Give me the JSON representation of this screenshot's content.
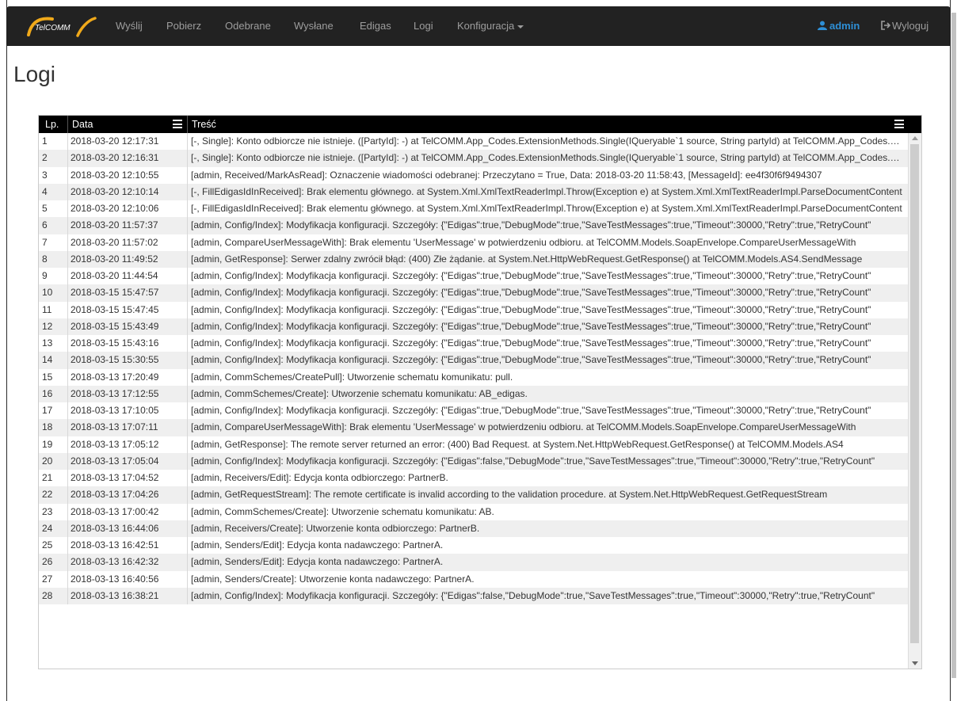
{
  "brand": {
    "logo_text": "TelCOMM"
  },
  "nav": {
    "items": [
      "Wyślij",
      "Pobierz",
      "Odebrane",
      "Wysłane",
      "Edigas",
      "Logi",
      "Konfiguracja"
    ],
    "user": "admin",
    "logout": "Wyloguj"
  },
  "page": {
    "title": "Logi"
  },
  "grid": {
    "columns": [
      "Lp.",
      "Data",
      "Treść"
    ],
    "rows": [
      [
        "1",
        "2018-03-20 12:17:31",
        "[-, Single]: Konto odbiorcze nie istnieje. ([PartyId]: -) at TelCOMM.App_Codes.ExtensionMethods.Single(IQueryable`1 source, String partyId) at TelCOMM.App_Codes.ExtensionMethods"
      ],
      [
        "2",
        "2018-03-20 12:16:31",
        "[-, Single]: Konto odbiorcze nie istnieje. ([PartyId]: -) at TelCOMM.App_Codes.ExtensionMethods.Single(IQueryable`1 source, String partyId) at TelCOMM.App_Codes.ExtensionMethods"
      ],
      [
        "3",
        "2018-03-20 12:10:55",
        "[admin, Received/MarkAsRead]: Oznaczenie wiadomości odebranej: Przeczytano = True, Data: 2018-03-20 11:58:43, [MessageId]: ee4f30f6f9494307"
      ],
      [
        "4",
        "2018-03-20 12:10:14",
        "[-, FillEdigasIdInReceived]: Brak elementu głównego. at System.Xml.XmlTextReaderImpl.Throw(Exception e) at System.Xml.XmlTextReaderImpl.ParseDocumentContent"
      ],
      [
        "5",
        "2018-03-20 12:10:06",
        "[-, FillEdigasIdInReceived]: Brak elementu głównego. at System.Xml.XmlTextReaderImpl.Throw(Exception e) at System.Xml.XmlTextReaderImpl.ParseDocumentContent"
      ],
      [
        "6",
        "2018-03-20 11:57:37",
        "[admin, Config/Index]: Modyfikacja konfiguracji. Szczegóły: {\"Edigas\":true,\"DebugMode\":true,\"SaveTestMessages\":true,\"Timeout\":30000,\"Retry\":true,\"RetryCount\""
      ],
      [
        "7",
        "2018-03-20 11:57:02",
        "[admin, CompareUserMessageWith]: Brak elementu 'UserMessage' w potwierdzeniu odbioru. at TelCOMM.Models.SoapEnvelope.CompareUserMessageWith"
      ],
      [
        "8",
        "2018-03-20 11:49:52",
        "[admin, GetResponse]: Serwer zdalny zwrócił błąd: (400) Złe żądanie. at System.Net.HttpWebRequest.GetResponse() at TelCOMM.Models.AS4.SendMessage"
      ],
      [
        "9",
        "2018-03-20 11:44:54",
        "[admin, Config/Index]: Modyfikacja konfiguracji. Szczegóły: {\"Edigas\":true,\"DebugMode\":true,\"SaveTestMessages\":true,\"Timeout\":30000,\"Retry\":true,\"RetryCount\""
      ],
      [
        "10",
        "2018-03-15 15:47:57",
        "[admin, Config/Index]: Modyfikacja konfiguracji. Szczegóły: {\"Edigas\":true,\"DebugMode\":true,\"SaveTestMessages\":true,\"Timeout\":30000,\"Retry\":true,\"RetryCount\""
      ],
      [
        "11",
        "2018-03-15 15:47:45",
        "[admin, Config/Index]: Modyfikacja konfiguracji. Szczegóły: {\"Edigas\":true,\"DebugMode\":true,\"SaveTestMessages\":true,\"Timeout\":30000,\"Retry\":true,\"RetryCount\""
      ],
      [
        "12",
        "2018-03-15 15:43:49",
        "[admin, Config/Index]: Modyfikacja konfiguracji. Szczegóły: {\"Edigas\":true,\"DebugMode\":true,\"SaveTestMessages\":true,\"Timeout\":30000,\"Retry\":true,\"RetryCount\""
      ],
      [
        "13",
        "2018-03-15 15:43:16",
        "[admin, Config/Index]: Modyfikacja konfiguracji. Szczegóły: {\"Edigas\":true,\"DebugMode\":true,\"SaveTestMessages\":true,\"Timeout\":30000,\"Retry\":true,\"RetryCount\""
      ],
      [
        "14",
        "2018-03-15 15:30:55",
        "[admin, Config/Index]: Modyfikacja konfiguracji. Szczegóły: {\"Edigas\":true,\"DebugMode\":true,\"SaveTestMessages\":true,\"Timeout\":30000,\"Retry\":true,\"RetryCount\""
      ],
      [
        "15",
        "2018-03-13 17:20:49",
        "[admin, CommSchemes/CreatePull]: Utworzenie schematu komunikatu: pull."
      ],
      [
        "16",
        "2018-03-13 17:12:55",
        "[admin, CommSchemes/Create]: Utworzenie schematu komunikatu: AB_edigas."
      ],
      [
        "17",
        "2018-03-13 17:10:05",
        "[admin, Config/Index]: Modyfikacja konfiguracji. Szczegóły: {\"Edigas\":true,\"DebugMode\":true,\"SaveTestMessages\":true,\"Timeout\":30000,\"Retry\":true,\"RetryCount\""
      ],
      [
        "18",
        "2018-03-13 17:07:11",
        "[admin, CompareUserMessageWith]: Brak elementu 'UserMessage' w potwierdzeniu odbioru. at TelCOMM.Models.SoapEnvelope.CompareUserMessageWith"
      ],
      [
        "19",
        "2018-03-13 17:05:12",
        "[admin, GetResponse]: The remote server returned an error: (400) Bad Request. at System.Net.HttpWebRequest.GetResponse() at TelCOMM.Models.AS4"
      ],
      [
        "20",
        "2018-03-13 17:05:04",
        "[admin, Config/Index]: Modyfikacja konfiguracji. Szczegóły: {\"Edigas\":false,\"DebugMode\":true,\"SaveTestMessages\":true,\"Timeout\":30000,\"Retry\":true,\"RetryCount\""
      ],
      [
        "21",
        "2018-03-13 17:04:52",
        "[admin, Receivers/Edit]: Edycja konta odbiorczego: PartnerB."
      ],
      [
        "22",
        "2018-03-13 17:04:26",
        "[admin, GetRequestStream]: The remote certificate is invalid according to the validation procedure. at System.Net.HttpWebRequest.GetRequestStream"
      ],
      [
        "23",
        "2018-03-13 17:00:42",
        "[admin, CommSchemes/Create]: Utworzenie schematu komunikatu: AB."
      ],
      [
        "24",
        "2018-03-13 16:44:06",
        "[admin, Receivers/Create]: Utworzenie konta odbiorczego: PartnerB."
      ],
      [
        "25",
        "2018-03-13 16:42:51",
        "[admin, Senders/Edit]: Edycja konta nadawczego: PartnerA."
      ],
      [
        "26",
        "2018-03-13 16:42:32",
        "[admin, Senders/Edit]: Edycja konta nadawczego: PartnerA."
      ],
      [
        "27",
        "2018-03-13 16:40:56",
        "[admin, Senders/Create]: Utworzenie konta nadawczego: PartnerA."
      ],
      [
        "28",
        "2018-03-13 16:38:21",
        "[admin, Config/Index]: Modyfikacja konfiguracji. Szczegóły: {\"Edigas\":false,\"DebugMode\":true,\"SaveTestMessages\":true,\"Timeout\":30000,\"Retry\":true,\"RetryCount\""
      ]
    ]
  },
  "colors": {
    "navbar": "#222222",
    "nav_text": "#9d9d9d",
    "admin": "#2e8fd6",
    "grid_header": "#000000",
    "row_alt": "#efefef"
  }
}
